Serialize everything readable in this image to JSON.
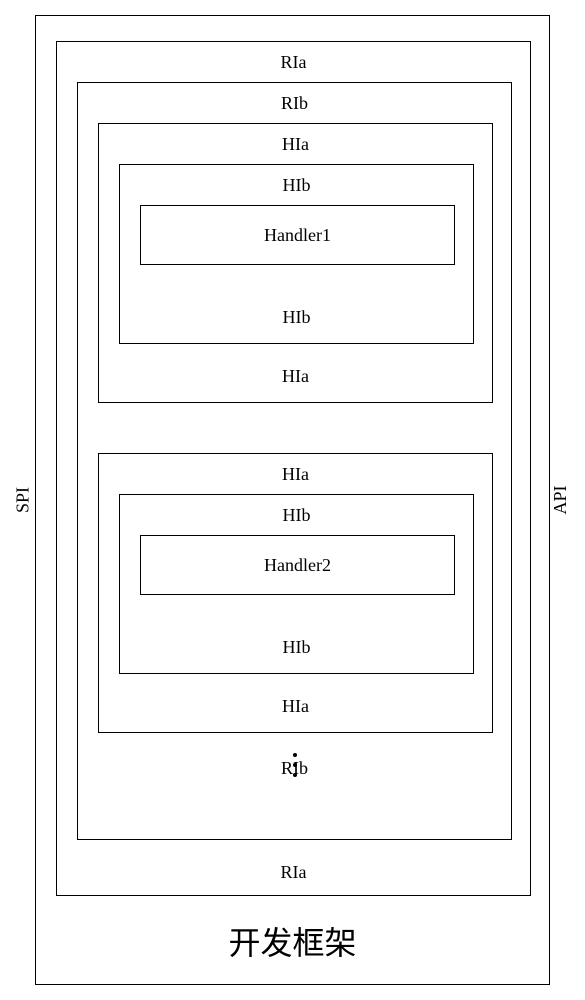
{
  "labels": {
    "spi": "SPI",
    "api": "API",
    "ria": "RIa",
    "rib": "RIb",
    "hia": "HIa",
    "hib": "HIb",
    "handler1": "Handler1",
    "handler2": "Handler2",
    "caption": "开发框架"
  }
}
